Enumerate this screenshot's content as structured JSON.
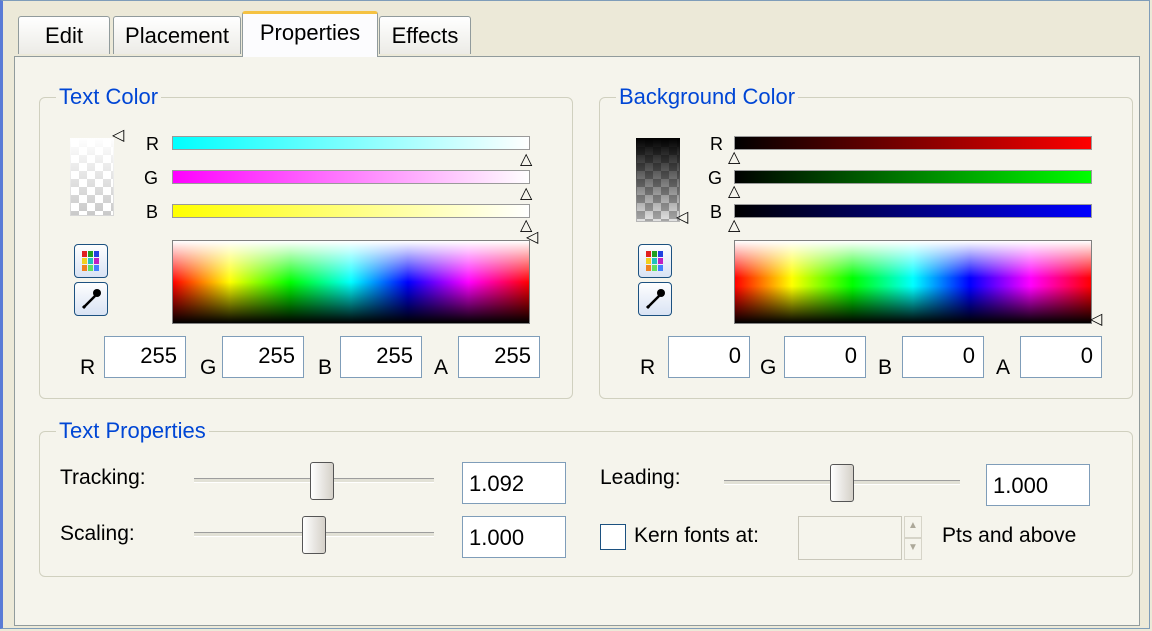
{
  "tabs": [
    {
      "label": "Edit"
    },
    {
      "label": "Placement"
    },
    {
      "label": "Properties"
    },
    {
      "label": "Effects"
    }
  ],
  "text_color": {
    "title": "Text Color",
    "channel_labels": {
      "r": "R",
      "g": "G",
      "b": "B"
    },
    "values": {
      "r": "255",
      "g": "255",
      "b": "255",
      "a": "255"
    },
    "field_labels": {
      "r": "R",
      "g": "G",
      "b": "B",
      "a": "A"
    },
    "slider_levels": {
      "r": 1.0,
      "g": 1.0,
      "b": 1.0,
      "a": 1.0
    }
  },
  "background_color": {
    "title": "Background Color",
    "channel_labels": {
      "r": "R",
      "g": "G",
      "b": "B"
    },
    "values": {
      "r": "0",
      "g": "0",
      "b": "0",
      "a": "0"
    },
    "field_labels": {
      "r": "R",
      "g": "G",
      "b": "B",
      "a": "A"
    },
    "slider_levels": {
      "r": 0.0,
      "g": 0.0,
      "b": 0.0,
      "a": 0.0
    }
  },
  "text_properties": {
    "title": "Text Properties",
    "tracking_label": "Tracking:",
    "tracking_value": "1.092",
    "scaling_label": "Scaling:",
    "scaling_value": "1.000",
    "leading_label": "Leading:",
    "leading_value": "1.000",
    "kern_label": "Kern fonts at:",
    "kern_checked": false,
    "kern_value": "",
    "kern_suffix": "Pts and above"
  },
  "icons": [
    "palette-icon",
    "eyedropper-icon"
  ],
  "colors": {
    "accent": "#0046d5",
    "tab_highlight": "#f5c242",
    "background": "#ece9d8"
  }
}
